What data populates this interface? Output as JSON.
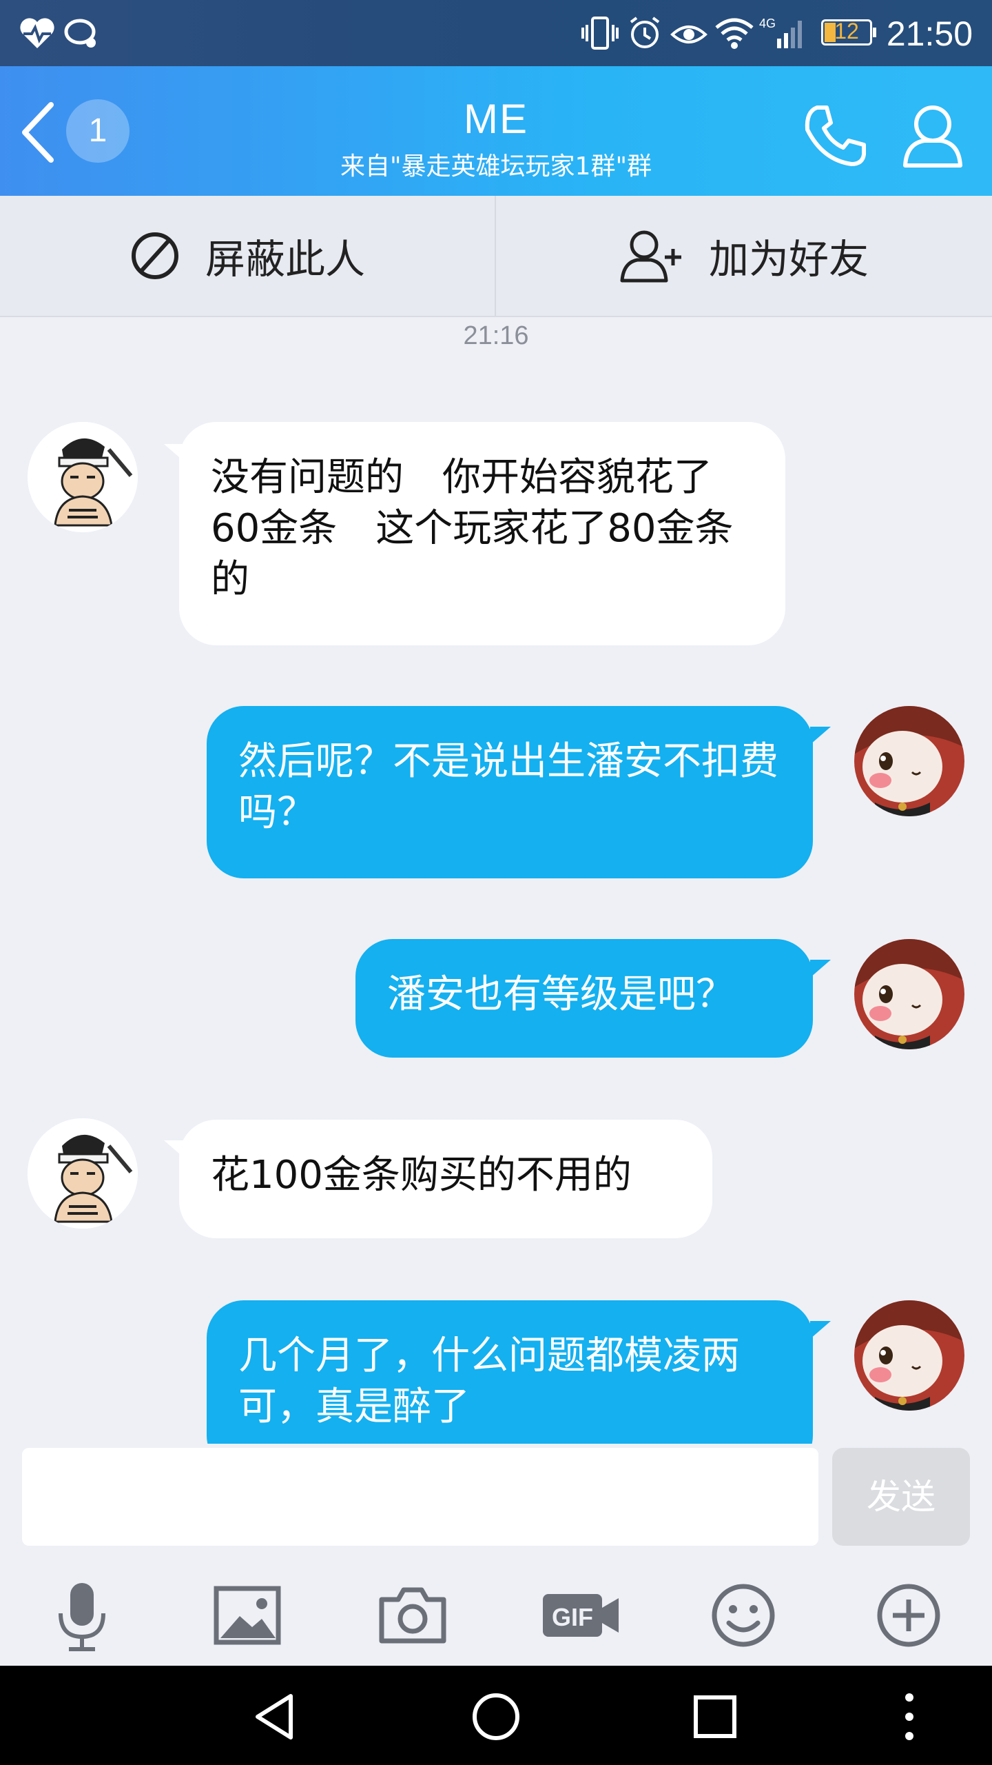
{
  "status_bar": {
    "time": "21:50",
    "battery": "12",
    "network": "4G"
  },
  "header": {
    "title": "ME",
    "subtitle": "来自\"暴走英雄坛玩家1群\"群",
    "unread_count": "1"
  },
  "actions": {
    "block": "屏蔽此人",
    "add_friend": "加为好友"
  },
  "chat": {
    "timestamp": "21:16",
    "messages": [
      {
        "dir": "in",
        "text": "没有问题的　你开始容貌花了60金条　这个玩家花了80金条的"
      },
      {
        "dir": "out",
        "text": "然后呢？不是说出生潘安不扣费吗？"
      },
      {
        "dir": "out",
        "text": "潘安也有等级是吧？"
      },
      {
        "dir": "in",
        "text": "花100金条购买的不用的"
      },
      {
        "dir": "out",
        "text": "几个月了，什么问题都模凌两可，真是醉了"
      }
    ]
  },
  "input": {
    "placeholder": "",
    "send_label": "发送"
  },
  "toolbar_icons": [
    "microphone-icon",
    "image-icon",
    "camera-icon",
    "gif-icon",
    "emoji-icon",
    "plus-icon"
  ],
  "colors": {
    "header_start": "#3f8ff0",
    "header_end": "#2fbaf7",
    "bubble_out": "#14b0f0",
    "bubble_in": "#ffffff",
    "background": "#eef0f6"
  }
}
